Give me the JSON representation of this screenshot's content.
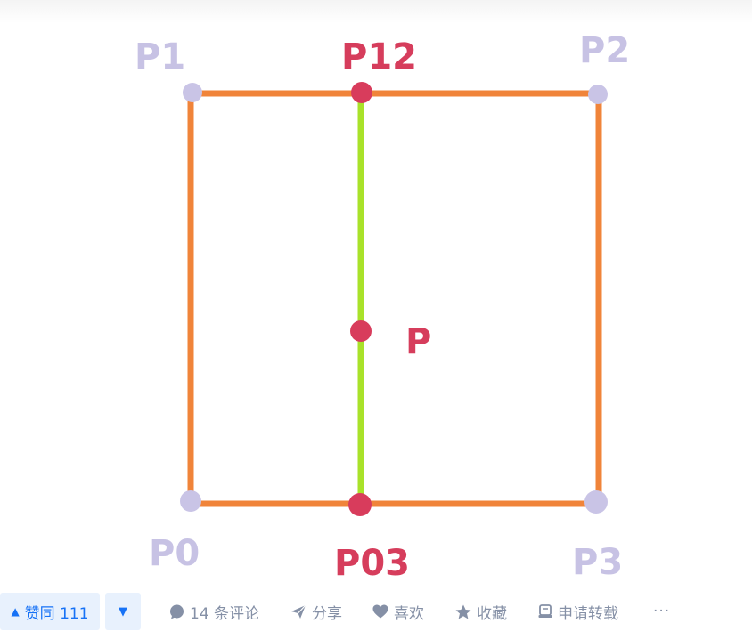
{
  "figure": {
    "labels": {
      "p1": "P1",
      "p12": "P12",
      "p2": "P2",
      "p": "P",
      "p0": "P0",
      "p03": "P03",
      "p3": "P3"
    },
    "colors": {
      "rect_edge": "#f0843a",
      "mid_line": "#a9e22a",
      "corner_point": "#c9c4e6",
      "corner_label": "#c7c2e4",
      "key_point": "#d83c5c",
      "key_label": "#d63d5c"
    }
  },
  "action_bar": {
    "upvote_label": "赞同 111",
    "upvote_icon": "triangle-up-icon",
    "downvote_icon": "triangle-down-icon",
    "comment_label": "14 条评论",
    "comment_icon": "comment-bubble-icon",
    "share_label": "分享",
    "share_icon": "paper-plane-icon",
    "like_label": "喜欢",
    "like_icon": "heart-icon",
    "collect_label": "收藏",
    "collect_icon": "star-icon",
    "repost_label": "申请转载",
    "repost_icon": "document-icon",
    "more_label": "···",
    "colors": {
      "vote_bg": "#e8f1fd",
      "vote_text": "#1772f6",
      "action_text": "#8590a6"
    }
  }
}
